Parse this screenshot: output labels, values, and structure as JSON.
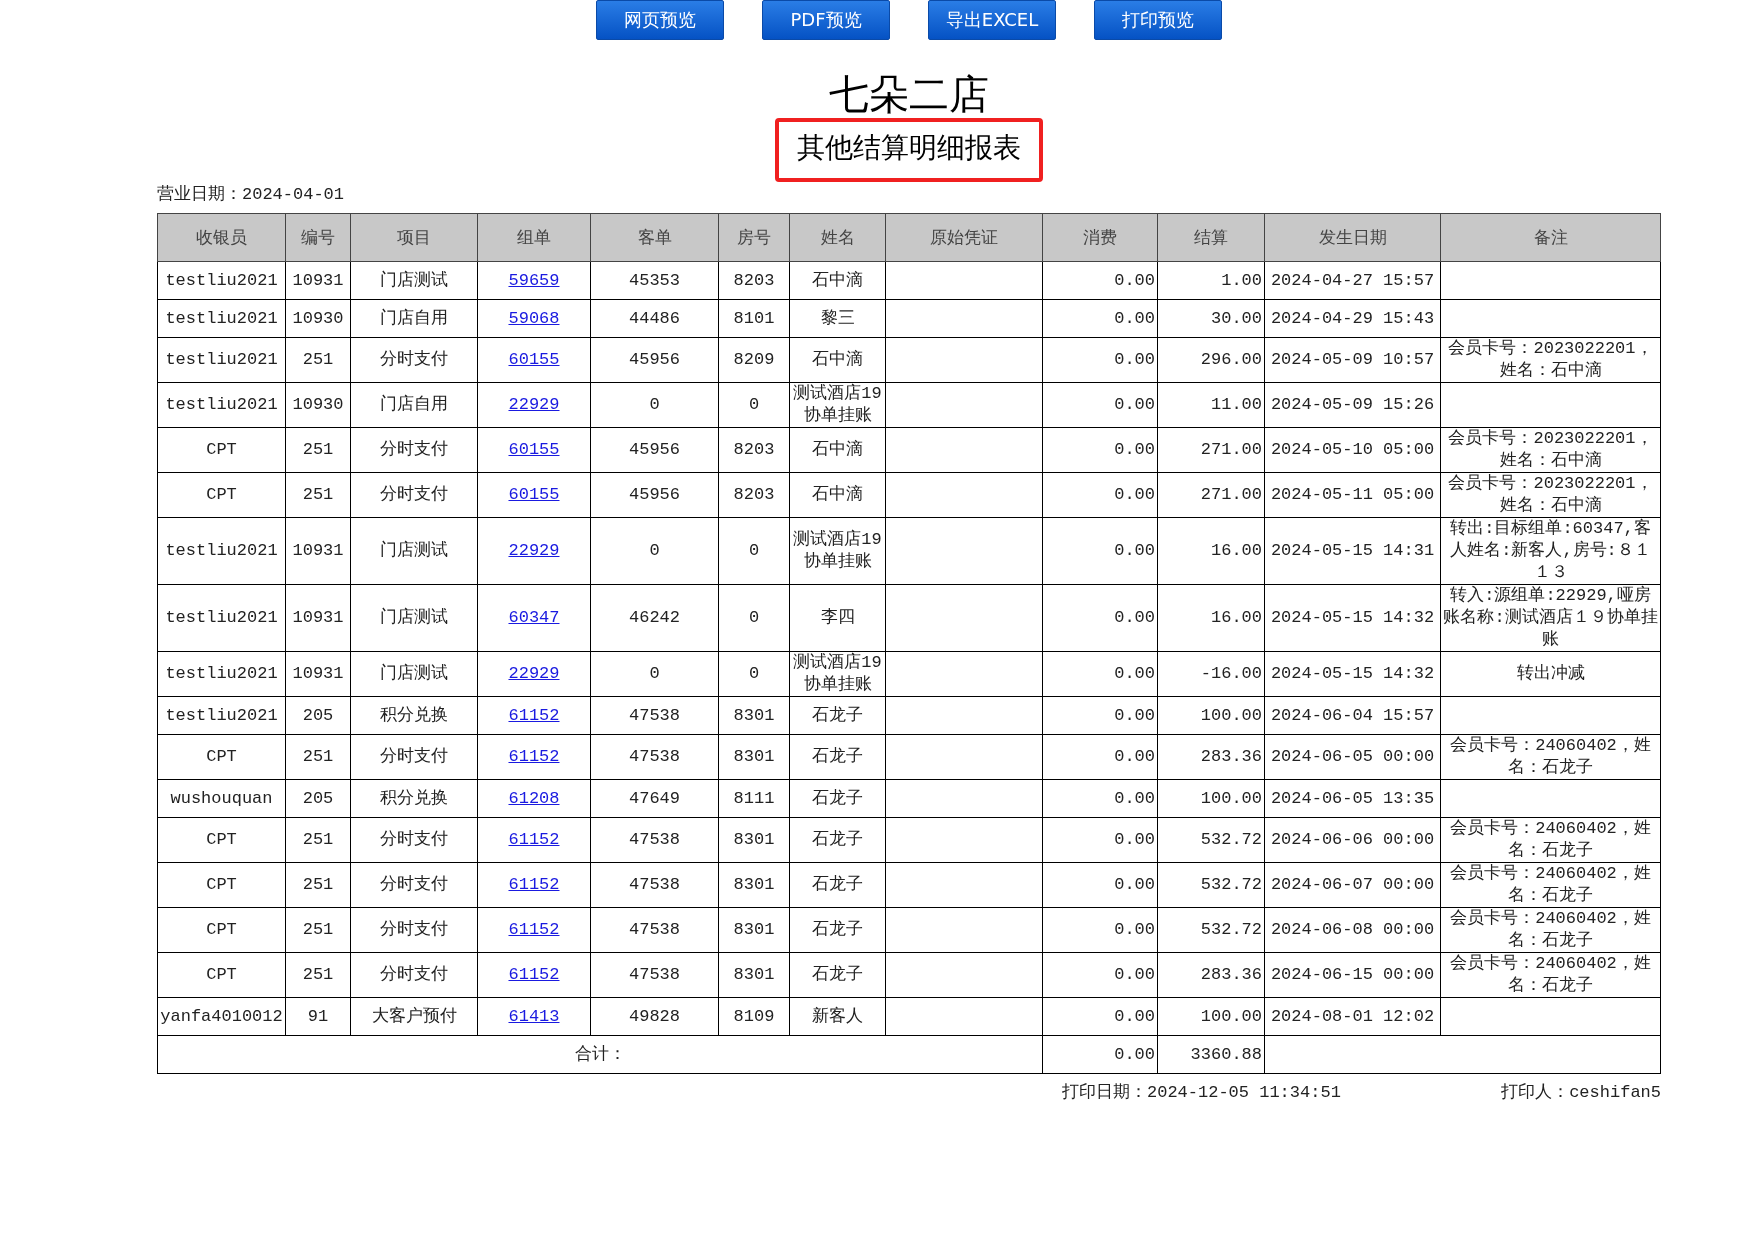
{
  "toolbar": {
    "buttons": [
      "网页预览",
      "PDF预览",
      "导出EXCEL",
      "打印预览"
    ]
  },
  "store_title": "七朵二店",
  "report_title": "其他结算明细报表",
  "business_date": "营业日期：2024-04-01",
  "table": {
    "columns": [
      "收银员",
      "编号",
      "项目",
      "组单",
      "客单",
      "房号",
      "姓名",
      "原始凭证",
      "消费",
      "结算",
      "发生日期",
      "备注"
    ],
    "rows": [
      [
        "testliu2021",
        "10931",
        "门店测试",
        "59659",
        "45353",
        "8203",
        "石中滴",
        "",
        "0.00",
        "1.00",
        "2024-04-27 15:57",
        ""
      ],
      [
        "testliu2021",
        "10930",
        "门店自用",
        "59068",
        "44486",
        "8101",
        "黎三",
        "",
        "0.00",
        "30.00",
        "2024-04-29 15:43",
        ""
      ],
      [
        "testliu2021",
        "251",
        "分时支付",
        "60155",
        "45956",
        "8209",
        "石中滴",
        "",
        "0.00",
        "296.00",
        "2024-05-09 10:57",
        "会员卡号：2023022201，姓名：石中滴"
      ],
      [
        "testliu2021",
        "10930",
        "门店自用",
        "22929",
        "0",
        "0",
        "测试酒店19协单挂账",
        "",
        "0.00",
        "11.00",
        "2024-05-09 15:26",
        ""
      ],
      [
        "CPT",
        "251",
        "分时支付",
        "60155",
        "45956",
        "8203",
        "石中滴",
        "",
        "0.00",
        "271.00",
        "2024-05-10 05:00",
        "会员卡号：2023022201，姓名：石中滴"
      ],
      [
        "CPT",
        "251",
        "分时支付",
        "60155",
        "45956",
        "8203",
        "石中滴",
        "",
        "0.00",
        "271.00",
        "2024-05-11 05:00",
        "会员卡号：2023022201，姓名：石中滴"
      ],
      [
        "testliu2021",
        "10931",
        "门店测试",
        "22929",
        "0",
        "0",
        "测试酒店19协单挂账",
        "",
        "0.00",
        "16.00",
        "2024-05-15 14:31",
        "转出:目标组单:60347,客人姓名:新客人,房号:８１１３"
      ],
      [
        "testliu2021",
        "10931",
        "门店测试",
        "60347",
        "46242",
        "0",
        "李四",
        "",
        "0.00",
        "16.00",
        "2024-05-15 14:32",
        "转入:源组单:22929,哑房账名称:测试酒店１９协单挂账"
      ],
      [
        "testliu2021",
        "10931",
        "门店测试",
        "22929",
        "0",
        "0",
        "测试酒店19协单挂账",
        "",
        "0.00",
        "-16.00",
        "2024-05-15 14:32",
        "转出冲减"
      ],
      [
        "testliu2021",
        "205",
        "积分兑换",
        "61152",
        "47538",
        "8301",
        "石龙子",
        "",
        "0.00",
        "100.00",
        "2024-06-04 15:57",
        ""
      ],
      [
        "CPT",
        "251",
        "分时支付",
        "61152",
        "47538",
        "8301",
        "石龙子",
        "",
        "0.00",
        "283.36",
        "2024-06-05 00:00",
        "会员卡号：24060402，姓名：石龙子"
      ],
      [
        "wushouquan",
        "205",
        "积分兑换",
        "61208",
        "47649",
        "8111",
        "石龙子",
        "",
        "0.00",
        "100.00",
        "2024-06-05 13:35",
        ""
      ],
      [
        "CPT",
        "251",
        "分时支付",
        "61152",
        "47538",
        "8301",
        "石龙子",
        "",
        "0.00",
        "532.72",
        "2024-06-06 00:00",
        "会员卡号：24060402，姓名：石龙子"
      ],
      [
        "CPT",
        "251",
        "分时支付",
        "61152",
        "47538",
        "8301",
        "石龙子",
        "",
        "0.00",
        "532.72",
        "2024-06-07 00:00",
        "会员卡号：24060402，姓名：石龙子"
      ],
      [
        "CPT",
        "251",
        "分时支付",
        "61152",
        "47538",
        "8301",
        "石龙子",
        "",
        "0.00",
        "532.72",
        "2024-06-08 00:00",
        "会员卡号：24060402，姓名：石龙子"
      ],
      [
        "CPT",
        "251",
        "分时支付",
        "61152",
        "47538",
        "8301",
        "石龙子",
        "",
        "0.00",
        "283.36",
        "2024-06-15 00:00",
        "会员卡号：24060402，姓名：石龙子"
      ],
      [
        "yanfa4010012",
        "91",
        "大客户预付",
        "61413",
        "49828",
        "8109",
        "新客人",
        "",
        "0.00",
        "100.00",
        "2024-08-01 12:02",
        ""
      ]
    ],
    "total": {
      "label": "合计：",
      "consumption": "0.00",
      "settlement": "3360.88"
    }
  },
  "footer": {
    "print_date": "打印日期：2024-12-05 11:34:51",
    "printed_by": "打印人：ceshifan5"
  }
}
